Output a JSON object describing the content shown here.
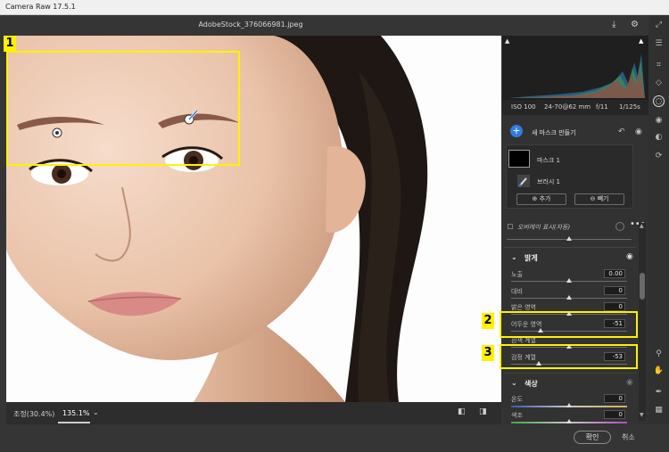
{
  "window": {
    "title": "Camera Raw 17.5.1",
    "filename": "AdobeStock_376066981.jpeg"
  },
  "toolbar": {
    "save_icon": "download-icon",
    "settings_icon": "gear-icon"
  },
  "exif": {
    "iso": "ISO 100",
    "lens": "24-70@62 mm",
    "aperture": "f/11",
    "shutter": "1/125s"
  },
  "mask": {
    "new_mask_label": "새 마스크 만들기",
    "mask_name": "마스크 1",
    "brush_name": "브러시 1",
    "add_label": "추가",
    "subtract_label": "빼기",
    "overlay_label": "오버레이 표시(자동)"
  },
  "light": {
    "title": "밝게",
    "rows": [
      {
        "label": "노출",
        "value": "0.00",
        "pos": 0.5
      },
      {
        "label": "대비",
        "value": "0",
        "pos": 0.5
      },
      {
        "label": "밝은 영역",
        "value": "0",
        "pos": 0.5
      },
      {
        "label": "어두운 영역",
        "value": "-51",
        "pos": 0.25
      },
      {
        "label": "흰색 계열",
        "value": "",
        "pos": 0.5
      },
      {
        "label": "검정 계열",
        "value": "-53",
        "pos": 0.24
      }
    ]
  },
  "color": {
    "title": "색상",
    "rows": [
      {
        "label": "온도",
        "value": "0",
        "pos": 0.5
      },
      {
        "label": "색조",
        "value": "0",
        "pos": 0.5
      }
    ]
  },
  "bottom": {
    "fit_label": "조정(30.4%)",
    "zoom_label": "135.1%",
    "ok_label": "확인",
    "cancel_label": "취소"
  },
  "annotations": [
    "1",
    "2",
    "3"
  ],
  "colors": {
    "accent": "#2f7de1",
    "highlight": "#fff200"
  }
}
